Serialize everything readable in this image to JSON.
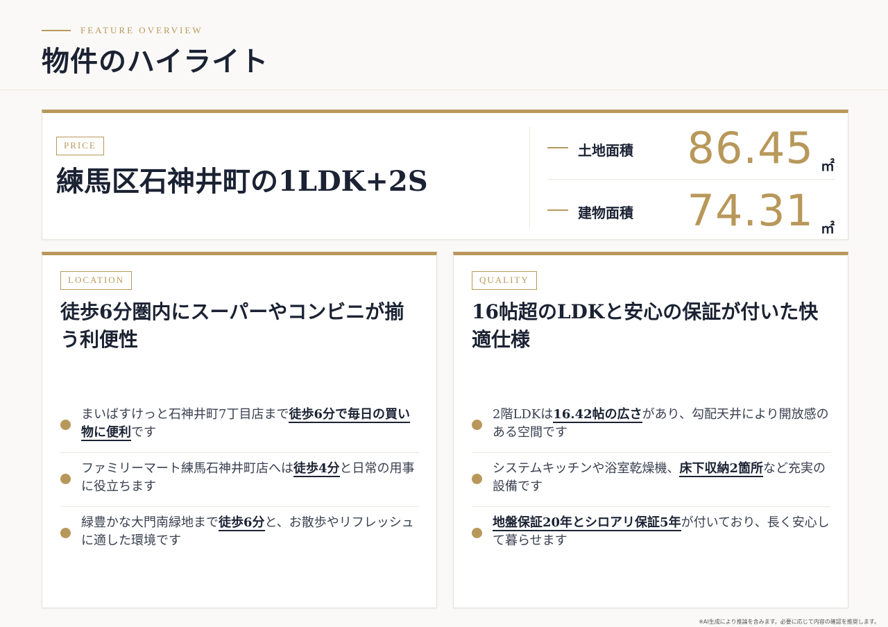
{
  "header": {
    "eyebrow": "FEATURE OVERVIEW",
    "title": "物件のハイライト"
  },
  "price": {
    "tag": "PRICE",
    "headline": "練馬区石神井町の1LDK+2S",
    "areas": [
      {
        "label": "土地面積",
        "value": "86.45",
        "unit": "㎡"
      },
      {
        "label": "建物面積",
        "value": "74.31",
        "unit": "㎡"
      }
    ]
  },
  "location": {
    "tag": "LOCATION",
    "title": "徒歩6分圏内にスーパーやコンビニが揃う利便性",
    "bullets": [
      {
        "pre": "まいばすけっと石神井町7丁目店まで",
        "em": "徒歩6分で毎日の買い物に便利",
        "post": "です"
      },
      {
        "pre": "ファミリーマート練馬石神井町店へは",
        "em": "徒歩4分",
        "post": "と日常の用事に役立ちます"
      },
      {
        "pre": "緑豊かな大門南緑地まで",
        "em": "徒歩6分",
        "post": "と、お散歩やリフレッシュに適した環境です"
      }
    ]
  },
  "quality": {
    "tag": "QUALITY",
    "title": "16帖超のLDKと安心の保証が付いた快適仕様",
    "bullets": [
      {
        "pre": "2階LDKは",
        "em": "16.42帖の広さ",
        "post": "があり、勾配天井により開放感のある空間です"
      },
      {
        "pre": "システムキッチンや浴室乾燥機、",
        "em": "床下収納2箇所",
        "post": "など充実の設備です"
      },
      {
        "pre": "",
        "em": "地盤保証20年とシロアリ保証5年",
        "post": "が付いており、長く安心して暮らせます"
      }
    ]
  },
  "footnote": "※AI生成により推論を含みます。必要に応じて内容の確認を推奨します。"
}
